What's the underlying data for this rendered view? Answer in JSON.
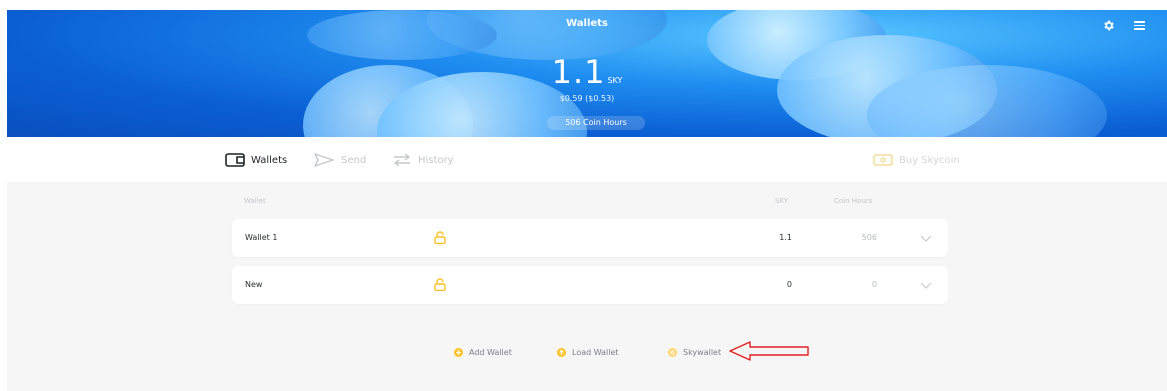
{
  "header": {
    "title": "Wallets",
    "balance": "1.1",
    "unit": "SKY",
    "fiat": "$0.59 ($0.53)",
    "coin_hours": "506 Coin Hours"
  },
  "nav": {
    "wallets": "Wallets",
    "send": "Send",
    "history": "History",
    "buy": "Buy Skycoin"
  },
  "table": {
    "columns": {
      "wallet": "Wallet",
      "sky": "SKY",
      "hours": "Coin Hours"
    },
    "rows": [
      {
        "name": "Wallet 1",
        "sky": "1.1",
        "hours": "506"
      },
      {
        "name": "New",
        "sky": "0",
        "hours": "0"
      }
    ]
  },
  "actions": {
    "add": "Add Wallet",
    "load": "Load Wallet",
    "hw": "Skywallet"
  },
  "colors": {
    "accent": "#ffc125",
    "hero": "#1f8ef1",
    "annotation_arrow": "#e02020"
  }
}
